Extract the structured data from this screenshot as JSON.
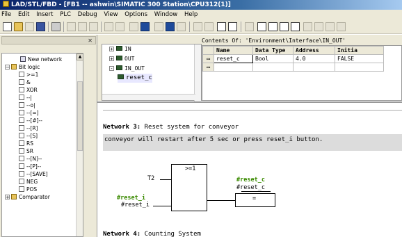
{
  "window": {
    "title": "LAD/STL/FBD - [FB1 -- ashwin\\SIMATIC 300 Station\\CPU312(1)]"
  },
  "menu": [
    "File",
    "Edit",
    "Insert",
    "PLC",
    "Debug",
    "View",
    "Options",
    "Window",
    "Help"
  ],
  "catalog": {
    "items": [
      {
        "label": "New network",
        "icon": "network-icon"
      },
      {
        "label": "Bit logic",
        "icon": "folder-icon",
        "expanded": true
      },
      {
        "label": ">=1",
        "icon": "or-gate-icon"
      },
      {
        "label": "&",
        "icon": "and-gate-icon"
      },
      {
        "label": "XOR",
        "icon": "xor-gate-icon"
      },
      {
        "label": "--|",
        "icon": "contact-icon"
      },
      {
        "label": "--o|",
        "icon": "negated-contact-icon"
      },
      {
        "label": "--[=]",
        "icon": "assign-icon"
      },
      {
        "label": "--[#]--",
        "icon": "midline-icon"
      },
      {
        "label": "--[R]",
        "icon": "reset-coil-icon"
      },
      {
        "label": "--[S]",
        "icon": "set-coil-icon"
      },
      {
        "label": "RS",
        "icon": "rs-flipflop-icon"
      },
      {
        "label": "SR",
        "icon": "sr-flipflop-icon"
      },
      {
        "label": "--[N]--",
        "icon": "neg-edge-icon"
      },
      {
        "label": "--[P]--",
        "icon": "pos-edge-icon"
      },
      {
        "label": "--[SAVE]",
        "icon": "save-bit-icon"
      },
      {
        "label": "NEG",
        "icon": "neg-icon"
      },
      {
        "label": "POS",
        "icon": "pos-icon"
      },
      {
        "label": "Comparator",
        "icon": "folder-icon",
        "expanded": false
      }
    ]
  },
  "interface": {
    "contents_label": "Contents Of: 'Environment\\Interface\\IN_OUT'",
    "tree": [
      {
        "label": "IN",
        "expander": "+"
      },
      {
        "label": "OUT",
        "expander": "+"
      },
      {
        "label": "IN_OUT",
        "expander": "-"
      },
      {
        "label": "reset_c",
        "expander": ""
      }
    ],
    "columns": [
      "Name",
      "Data Type",
      "Address",
      "Initia"
    ],
    "rows": [
      {
        "name": "reset_c",
        "type": "Bool",
        "address": "4.0",
        "initial": "FALSE"
      }
    ]
  },
  "network3": {
    "label": "Network 3",
    "title": "Reset system for conveyor",
    "comment": "conveyor will restart after 5 sec or press reset_i button.",
    "gate_label": ">=1",
    "input1": "T2",
    "input2_symbol": "#reset_i",
    "input2_name": "#reset_i",
    "output_symbol": "#reset_c",
    "output_name": "#reset_c",
    "assign_label": "="
  },
  "network4": {
    "label": "Network 4",
    "title": "Counting System"
  },
  "colors": {
    "title_bar": "#0a246a",
    "symbol_green": "#3a8a00",
    "comment_bg": "#dcdcdc"
  }
}
